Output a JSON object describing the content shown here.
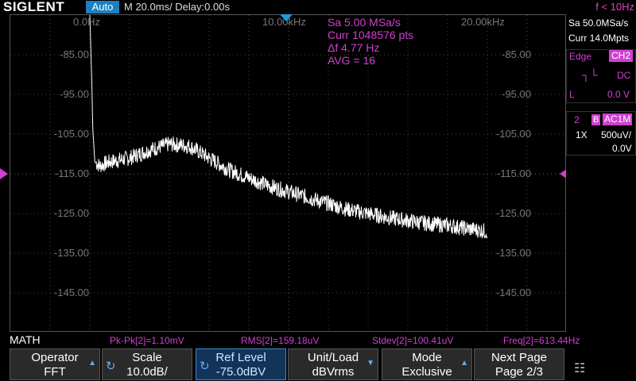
{
  "header": {
    "brand": "SIGLENT",
    "mode": "Auto",
    "timebase": "M 20.0ms/ Delay:0.00s",
    "trigger_freq": "f < 10Hz"
  },
  "math_info": {
    "sample_rate": "Sa 5.00 MSa/s",
    "points": "Curr 1048576 pts",
    "delta_f": "Δf 4.77 Hz",
    "avg": "AVG = 16"
  },
  "freq_labels": [
    "0.0Hz",
    "10.00kHz",
    "20.00kHz"
  ],
  "db_labels": [
    "-85.00",
    "-95.00",
    "-105.00",
    "-115.00",
    "-125.00",
    "-135.00",
    "-145.00"
  ],
  "right_panel": {
    "sample_rate": "Sa 50.0MSa/s",
    "memory": "Curr 14.0Mpts",
    "trigger_type": "Edge",
    "trigger_source": "CH2",
    "coupling": "DC",
    "level_label": "L",
    "level_value": "0.0 V",
    "channel_num": "2",
    "bw_flag": "B",
    "channel_coupling": "AC1M",
    "probe": "1X",
    "scale": "500uV/",
    "offset": "0.0V"
  },
  "measurements": {
    "label": "MATH",
    "pkpk": "Pk-Pk[2]=1.10mV",
    "rms": "RMS[2]=159.18uV",
    "stdev": "Stdev[2]=100.41uV",
    "freq": "Freq[2]=613.44Hz"
  },
  "softkeys": [
    {
      "title": "Operator",
      "value": "FFT"
    },
    {
      "title": "Scale",
      "value": "10.0dB/"
    },
    {
      "title": "Ref Level",
      "value": "-75.0dBV"
    },
    {
      "title": "Unit/Load",
      "value": "dBVrms"
    },
    {
      "title": "Mode",
      "value": "Exclusive"
    },
    {
      "title": "Next Page",
      "value": "Page 2/3"
    }
  ],
  "colors": {
    "math_trace": "#ffffff",
    "channel2": "#d040d0",
    "accent": "#1e7fc2"
  },
  "chart_data": {
    "type": "line",
    "x_unit": "Hz",
    "y_unit": "dBVrms",
    "xlim": [
      0,
      25000
    ],
    "ylim": [
      -155,
      -75
    ],
    "x": [
      0,
      100,
      150,
      250,
      500,
      1000,
      2000,
      3000,
      4000,
      5000,
      6000,
      7000,
      8000,
      9000,
      10000,
      11000,
      12000,
      13000,
      14000,
      15000,
      16000,
      17000,
      18000,
      19000,
      20000
    ],
    "y": [
      -75,
      -92,
      -104,
      -112,
      -113,
      -112,
      -111,
      -109,
      -107.5,
      -108,
      -111,
      -114,
      -116,
      -118,
      -119.5,
      -121,
      -122.5,
      -124,
      -125,
      -126,
      -126.8,
      -127.5,
      -128,
      -128.8,
      -129.5
    ]
  }
}
